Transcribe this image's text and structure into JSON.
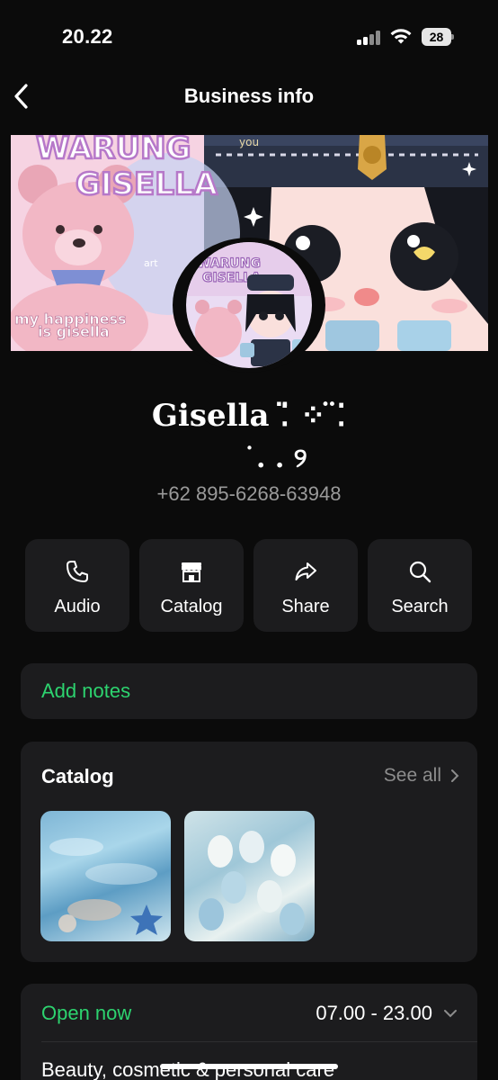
{
  "status_bar": {
    "time": "20.22",
    "battery": "28"
  },
  "nav": {
    "title": "Business info"
  },
  "banner": {
    "line1": "WARUNG",
    "line2": "GISELLA",
    "line3": "my happiness",
    "line4": "is gisella",
    "tag_you": "you",
    "tag_art": "art",
    "avatar_line1": "WARUNG",
    "avatar_line2": "GISELLA"
  },
  "profile": {
    "name_line1": "Gisella ⁚̈ ⁘ ̈⁚",
    "name_line2": "˙. . ୨",
    "phone": "+62 895-6268-63948"
  },
  "actions": [
    {
      "label": "Audio",
      "icon": "phone-icon"
    },
    {
      "label": "Catalog",
      "icon": "storefront-icon"
    },
    {
      "label": "Share",
      "icon": "share-arrow-icon"
    },
    {
      "label": "Search",
      "icon": "search-icon"
    }
  ],
  "notes": {
    "label": "Add notes"
  },
  "catalog": {
    "title": "Catalog",
    "see_all": "See all"
  },
  "hours": {
    "status": "Open now",
    "range": "07.00 - 23.00",
    "category": "Beauty, cosmetic & personal care"
  },
  "colors": {
    "accent_green": "#2dd36f",
    "card_bg": "#1c1c1e",
    "background": "#0b0b0b"
  }
}
